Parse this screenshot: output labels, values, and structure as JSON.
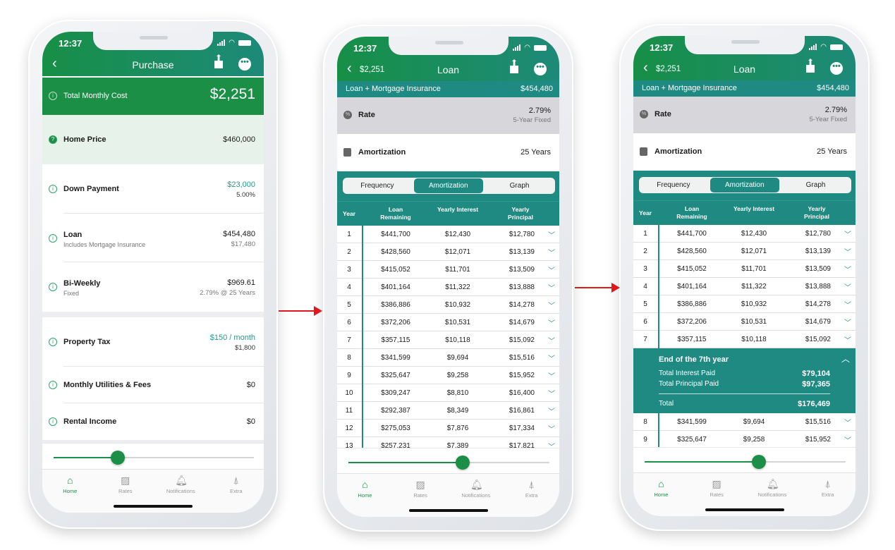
{
  "colors": {
    "green": "#1a8f45",
    "teal": "#1e8a82",
    "arrow": "#e0181b"
  },
  "status_time": "12:37",
  "tabs": [
    {
      "label": "Home",
      "icon": "house-icon",
      "active": true
    },
    {
      "label": "Rates",
      "icon": "chart-board-icon"
    },
    {
      "label": "Notifications",
      "icon": "bell-icon"
    },
    {
      "label": "Extra",
      "icon": "rocket-icon"
    }
  ],
  "purchase": {
    "title": "Purchase",
    "total_label": "Total Monthly Cost",
    "total_value": "$2,251",
    "items": [
      {
        "label": "Home Price",
        "value": "$460,000"
      },
      {
        "label": "Down Payment",
        "value": "$23,000",
        "sub_value": "5.00%"
      },
      {
        "label": "Loan",
        "sub": "Includes Mortgage Insurance",
        "value": "$454,480",
        "sub_value": "$17,480"
      },
      {
        "label": "Bi-Weekly",
        "sub": "Fixed",
        "value": "$969.61",
        "sub_value": "2.79% @ 25 Years"
      },
      {
        "label": "Property Tax",
        "value": "$150 / month",
        "sub_value": "$1,800"
      },
      {
        "label": "Monthly Utilities & Fees",
        "value": "$0"
      },
      {
        "label": "Rental Income",
        "value": "$0"
      }
    ],
    "slider_percent": 32
  },
  "loan": {
    "back_label": "$2,251",
    "title": "Loan",
    "summary_label": "Loan + Mortgage Insurance",
    "summary_value": "$454,480",
    "rate_label": "Rate",
    "rate_value": "2.79%",
    "rate_sub": "5-Year Fixed",
    "amort_label": "Amortization",
    "amort_value": "25 Years",
    "segments": [
      "Frequency",
      "Amortization",
      "Graph"
    ],
    "active_segment": 1,
    "columns": [
      "Year",
      "Loan Remaining",
      "Yearly Interest",
      "Yearly Principal"
    ],
    "rows": [
      [
        "1",
        "$441,700",
        "$12,430",
        "$12,780"
      ],
      [
        "2",
        "$428,560",
        "$12,071",
        "$13,139"
      ],
      [
        "3",
        "$415,052",
        "$11,701",
        "$13,509"
      ],
      [
        "4",
        "$401,164",
        "$11,322",
        "$13,888"
      ],
      [
        "5",
        "$386,886",
        "$10,932",
        "$14,278"
      ],
      [
        "6",
        "$372,206",
        "$10,531",
        "$14,679"
      ],
      [
        "7",
        "$357,115",
        "$10,118",
        "$15,092"
      ],
      [
        "8",
        "$341,599",
        "$9,694",
        "$15,516"
      ],
      [
        "9",
        "$325,647",
        "$9,258",
        "$15,952"
      ],
      [
        "10",
        "$309,247",
        "$8,810",
        "$16,400"
      ],
      [
        "11",
        "$292,387",
        "$8,349",
        "$16,861"
      ],
      [
        "12",
        "$275,053",
        "$7,876",
        "$17,334"
      ],
      [
        "13",
        "$257,231",
        "$7,389",
        "$17,821"
      ]
    ],
    "expanded": {
      "after_year": 7,
      "title": "End of the 7th year",
      "interest_label": "Total Interest Paid",
      "interest_value": "$79,104",
      "principal_label": "Total Principal Paid",
      "principal_value": "$97,365",
      "total_label": "Total",
      "total_value": "$176,469"
    },
    "slider_percent": 57
  }
}
